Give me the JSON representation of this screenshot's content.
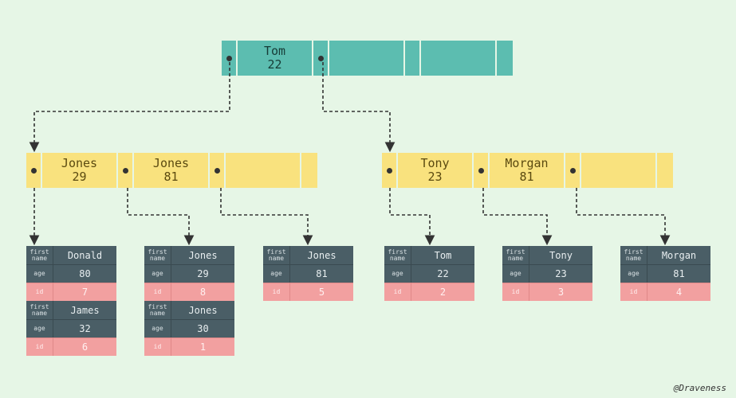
{
  "credit": "@Draveness",
  "root": {
    "keys": [
      {
        "name": "Tom",
        "value": "22"
      },
      null,
      null
    ]
  },
  "left": {
    "keys": [
      {
        "name": "Jones",
        "value": "29"
      },
      {
        "name": "Jones",
        "value": "81"
      },
      null
    ]
  },
  "right": {
    "keys": [
      {
        "name": "Tony",
        "value": "23"
      },
      {
        "name": "Morgan",
        "value": "81"
      },
      null
    ]
  },
  "records": {
    "r1a": {
      "first_name": "Donald",
      "age": "80",
      "id": "7"
    },
    "r1b": {
      "first_name": "James",
      "age": "32",
      "id": "6"
    },
    "r2a": {
      "first_name": "Jones",
      "age": "29",
      "id": "8"
    },
    "r2b": {
      "first_name": "Jones",
      "age": "30",
      "id": "1"
    },
    "r3": {
      "first_name": "Jones",
      "age": "81",
      "id": "5"
    },
    "r4": {
      "first_name": "Tom",
      "age": "22",
      "id": "2"
    },
    "r5": {
      "first_name": "Tony",
      "age": "23",
      "id": "3"
    },
    "r6": {
      "first_name": "Morgan",
      "age": "81",
      "id": "4"
    }
  },
  "labels": {
    "first_name": "first\nname",
    "age": "age",
    "id": "id"
  }
}
